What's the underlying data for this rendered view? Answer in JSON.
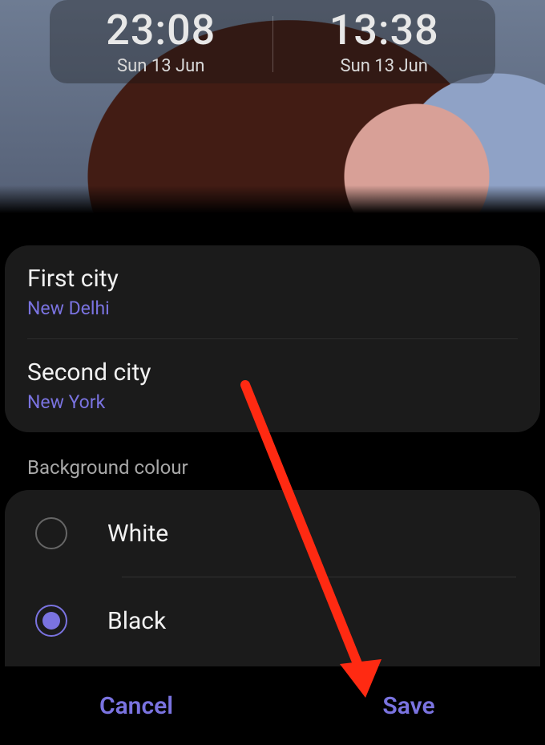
{
  "clock": {
    "left_time": "23:08",
    "left_date": "Sun 13 Jun",
    "right_time": "13:38",
    "right_date": "Sun 13 Jun"
  },
  "cities": {
    "first_label": "First city",
    "first_value": "New Delhi",
    "second_label": "Second city",
    "second_value": "New York"
  },
  "background": {
    "section_label": "Background colour",
    "white_label": "White",
    "black_label": "Black",
    "selected": "black"
  },
  "buttons": {
    "cancel": "Cancel",
    "save": "Save"
  },
  "accent_color": "#7a73e0",
  "arrow_color": "#ff2a12"
}
